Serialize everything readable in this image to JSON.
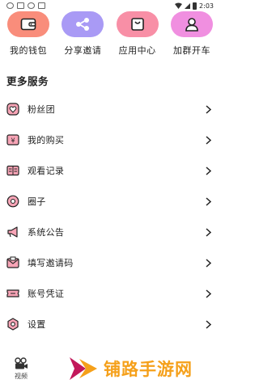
{
  "status_bar": {
    "time": "2:03"
  },
  "top_grid": [
    {
      "label": "我的钱包",
      "icon": "wallet-icon",
      "color": "#f98d7b"
    },
    {
      "label": "分享邀请",
      "icon": "share-icon",
      "color": "#a99af5"
    },
    {
      "label": "应用中心",
      "icon": "shopping-bag-icon",
      "color": "#f88fa6"
    },
    {
      "label": "加群开车",
      "icon": "user-group-icon",
      "color": "#f08fe0"
    }
  ],
  "section": {
    "title": "更多服务"
  },
  "list": [
    {
      "label": "粉丝团",
      "icon": "heart-icon"
    },
    {
      "label": "我的购买",
      "icon": "yen-icon"
    },
    {
      "label": "观看记录",
      "icon": "book-icon"
    },
    {
      "label": "圈子",
      "icon": "circle-icon"
    },
    {
      "label": "系统公告",
      "icon": "megaphone-icon"
    },
    {
      "label": "填写邀请码",
      "icon": "mail-icon"
    },
    {
      "label": "账号凭证",
      "icon": "ticket-icon"
    },
    {
      "label": "设置",
      "icon": "settings-icon"
    }
  ],
  "bottom_nav": {
    "video_label": "视频"
  },
  "watermark": {
    "text": "铺路手游网"
  },
  "colors": {
    "icon_fill": "#f7a4b6",
    "icon_stroke": "#222222",
    "watermark": "#f5a01a"
  }
}
